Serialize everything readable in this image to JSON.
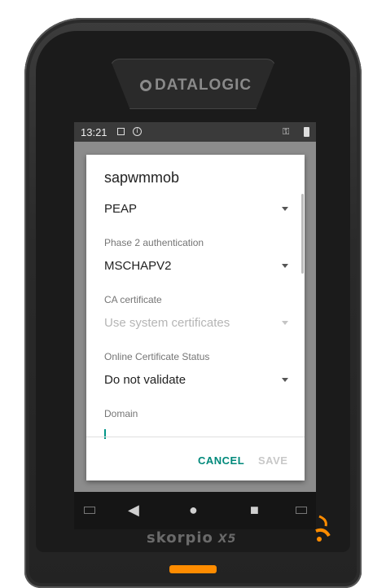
{
  "device": {
    "brand": "DATALOGIC",
    "model": "skorpio",
    "model_suffix": "X5"
  },
  "statusbar": {
    "time": "13:21"
  },
  "dialog": {
    "title": "sapwmmob",
    "eap_method": "PEAP",
    "phase2_label": "Phase 2 authentication",
    "phase2_value": "MSCHAPV2",
    "ca_label": "CA certificate",
    "ca_value": "Use system certificates",
    "ocsp_label": "Online Certificate Status",
    "ocsp_value": "Do not validate",
    "domain_label": "Domain",
    "domain_value": "",
    "cancel_label": "CANCEL",
    "save_label": "SAVE"
  },
  "colors": {
    "accent": "#00897b",
    "disabled": "#c8c8c8",
    "device_orange": "#ff8c00"
  }
}
